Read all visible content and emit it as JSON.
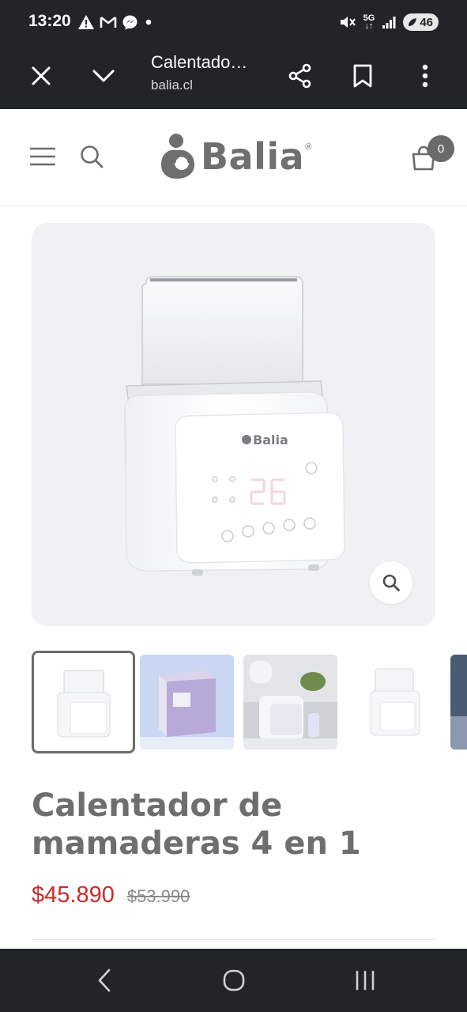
{
  "status_bar": {
    "time": "13:20",
    "network": "5G",
    "battery": "46",
    "left_icons": [
      "warning-icon",
      "gmail-icon",
      "messenger-icon",
      "dot-icon"
    ],
    "right_icons": [
      "mute-vibrate-icon",
      "5g-icon",
      "signal-icon",
      "battery-icon"
    ]
  },
  "browser": {
    "page_title": "Calentado…",
    "url": "balia.cl",
    "icons": [
      "close-icon",
      "chevron-down-icon",
      "share-icon",
      "bookmark-icon",
      "more-vert-icon"
    ]
  },
  "site_header": {
    "brand_name": "Balia",
    "brand_reg": "®",
    "cart_count": "0",
    "icons": [
      "menu-icon",
      "search-icon",
      "cart-icon"
    ]
  },
  "product_image": {
    "device_brand": "Balia",
    "zoom_icon": "magnify-icon"
  },
  "thumbnails": [
    {
      "name": "thumb-warmer-front",
      "selected": true
    },
    {
      "name": "thumb-box"
    },
    {
      "name": "thumb-lifestyle"
    },
    {
      "name": "thumb-warmer-small"
    },
    {
      "name": "thumb-partial"
    }
  ],
  "product": {
    "title": "Calentador de mamaderas 4 en 1",
    "sale_price": "$45.890",
    "regular_price": "$53.990"
  },
  "colors": {
    "sale_price": "#cc2a2a",
    "system_bar": "#222528",
    "brand_gray": "#6f6f6f"
  },
  "nav_bar": {
    "icons": [
      "back-icon",
      "home-icon",
      "recents-icon"
    ]
  }
}
